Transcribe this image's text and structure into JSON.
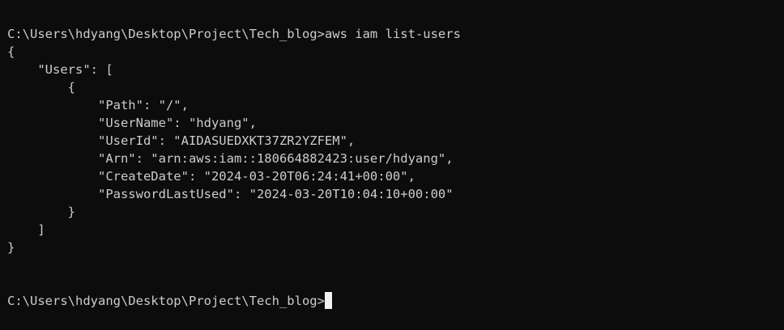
{
  "terminal": {
    "prompt1": "C:\\Users\\hdyang\\Desktop\\Project\\Tech_blog>",
    "command": "aws iam list-users",
    "output": [
      "{",
      "    \"Users\": [",
      "        {",
      "            \"Path\": \"/\",",
      "            \"UserName\": \"hdyang\",",
      "            \"UserId\": \"AIDASUEDXKT37ZR2YZFEM\",",
      "            \"Arn\": \"arn:aws:iam::180664882423:user/hdyang\",",
      "            \"CreateDate\": \"2024-03-20T06:24:41+00:00\",",
      "            \"PasswordLastUsed\": \"2024-03-20T10:04:10+00:00\"",
      "        }",
      "    ]",
      "}"
    ],
    "prompt2": "C:\\Users\\hdyang\\Desktop\\Project\\Tech_blog>",
    "colors": {
      "background": "#0c0c0c",
      "text": "#cccccc",
      "cursor": "#f2f2f2"
    }
  }
}
